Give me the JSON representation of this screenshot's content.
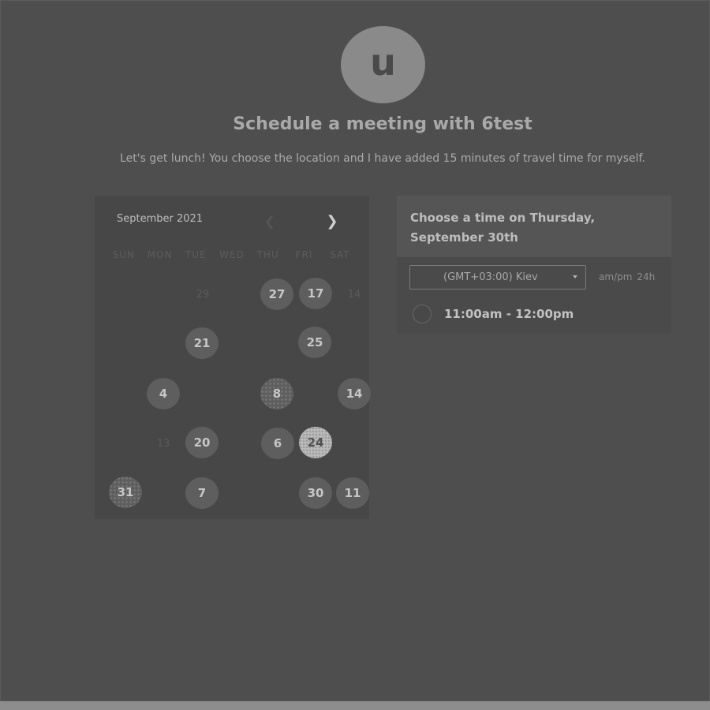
{
  "avatar": {
    "initial": "u"
  },
  "header": {
    "title": "Schedule a meeting with 6test",
    "description": "Let's get lunch! You choose the location and I have added 15 minutes of travel time for myself."
  },
  "calendar": {
    "month_label": "September 2021",
    "prev_icon": "chevron-left-icon",
    "next_icon": "chevron-right-icon",
    "weekdays": [
      "SUN",
      "MON",
      "TUE",
      "WED",
      "THU",
      "FRI",
      "SAT"
    ],
    "days": [
      {
        "label": "29",
        "state": "dim"
      },
      {
        "label": "27",
        "state": "available"
      },
      {
        "label": "17",
        "state": "available"
      },
      {
        "label": "14",
        "state": "dim"
      },
      {
        "label": "21",
        "state": "available"
      },
      {
        "label": "25",
        "state": "available"
      },
      {
        "label": "4",
        "state": "available"
      },
      {
        "label": "8",
        "state": "pattern"
      },
      {
        "label": "14",
        "state": "available"
      },
      {
        "label": "13",
        "state": "dim"
      },
      {
        "label": "20",
        "state": "available"
      },
      {
        "label": "6",
        "state": "available"
      },
      {
        "label": "24",
        "state": "selected"
      },
      {
        "label": "31",
        "state": "pattern"
      },
      {
        "label": "7",
        "state": "available"
      },
      {
        "label": "30",
        "state": "available"
      },
      {
        "label": "11",
        "state": "available"
      }
    ]
  },
  "time_panel": {
    "heading_line1": "Choose a time on Thursday,",
    "heading_line2": "September 30th",
    "timezone": "(GMT+03:00) Kiev",
    "format_ampm": "am/pm",
    "format_24h": "24h",
    "slots": [
      {
        "label": "11:00am - 12:00pm"
      }
    ]
  },
  "colors": {
    "background": "#4e4e4e",
    "selected_day": "#bbbbbb",
    "available_day": "#5e5e5e"
  }
}
